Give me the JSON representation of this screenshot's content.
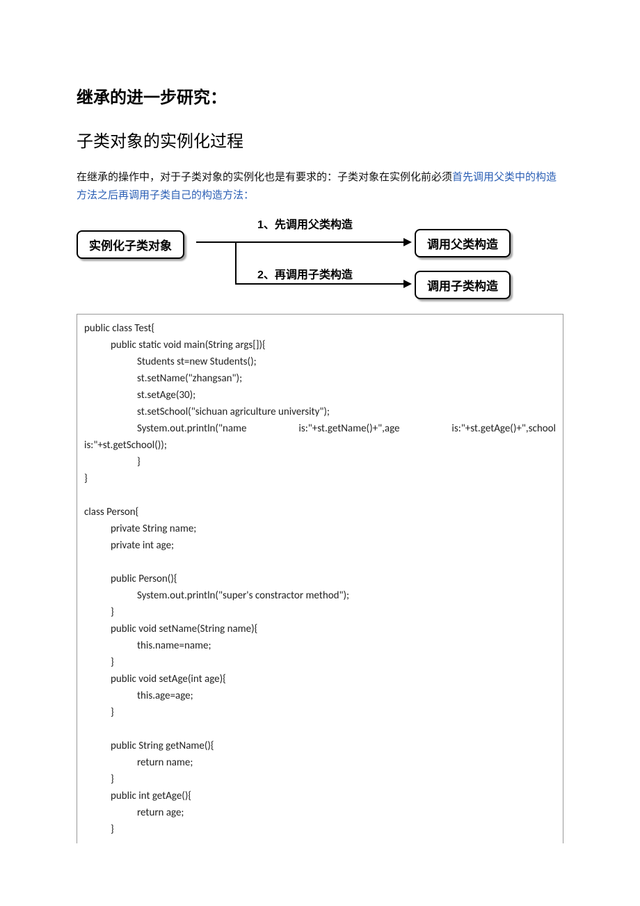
{
  "title": "继承的进一步研究：",
  "subtitle": "子类对象的实例化过程",
  "intro_plain": "在继承的操作中，对于子类对象的实例化也是有要求的：子类对象在实例化前必须",
  "intro_blue1": "首先调用父类中的构造方法之后再调用子类自己的构造方法",
  "intro_blue_tail": "：",
  "diagram": {
    "box_left": "实例化子类对象",
    "box_r1": "调用父类构造",
    "box_r2": "调用子类构造",
    "label1": "1、先调用父类构造",
    "label2": "2、再调用子类构造"
  },
  "code": {
    "l01": "public class Test{",
    "l02": "public static void main(String args[]){",
    "l03": "Students st=new Students();",
    "l04": "st.setName(\"zhangsan\");",
    "l05": "st.setAge(30);",
    "l06": "st.setSchool(\"sichuan agriculture university\");",
    "l07a": "System.out.println(\"name",
    "l07b": "is:\"+st.getName()+\",age",
    "l07c": "is:\"+st.getAge()+\",school",
    "l08": "is:\"+st.getSchool());",
    "l09": "}",
    "l10": "}",
    "l12": "class Person{",
    "l13": "private String name;",
    "l14": "private int age;",
    "l16": "public Person(){",
    "l17": "System.out.println(\"super's constractor method\");",
    "l18": "}",
    "l19": "public void setName(String name){",
    "l20": "this.name=name;",
    "l21": "}",
    "l22": "public void setAge(int age){",
    "l23": "this.age=age;",
    "l24": "}",
    "l26": "public String getName(){",
    "l27": "return name;",
    "l28": "}",
    "l29": "public int getAge(){",
    "l30": "return age;",
    "l31": "}"
  }
}
